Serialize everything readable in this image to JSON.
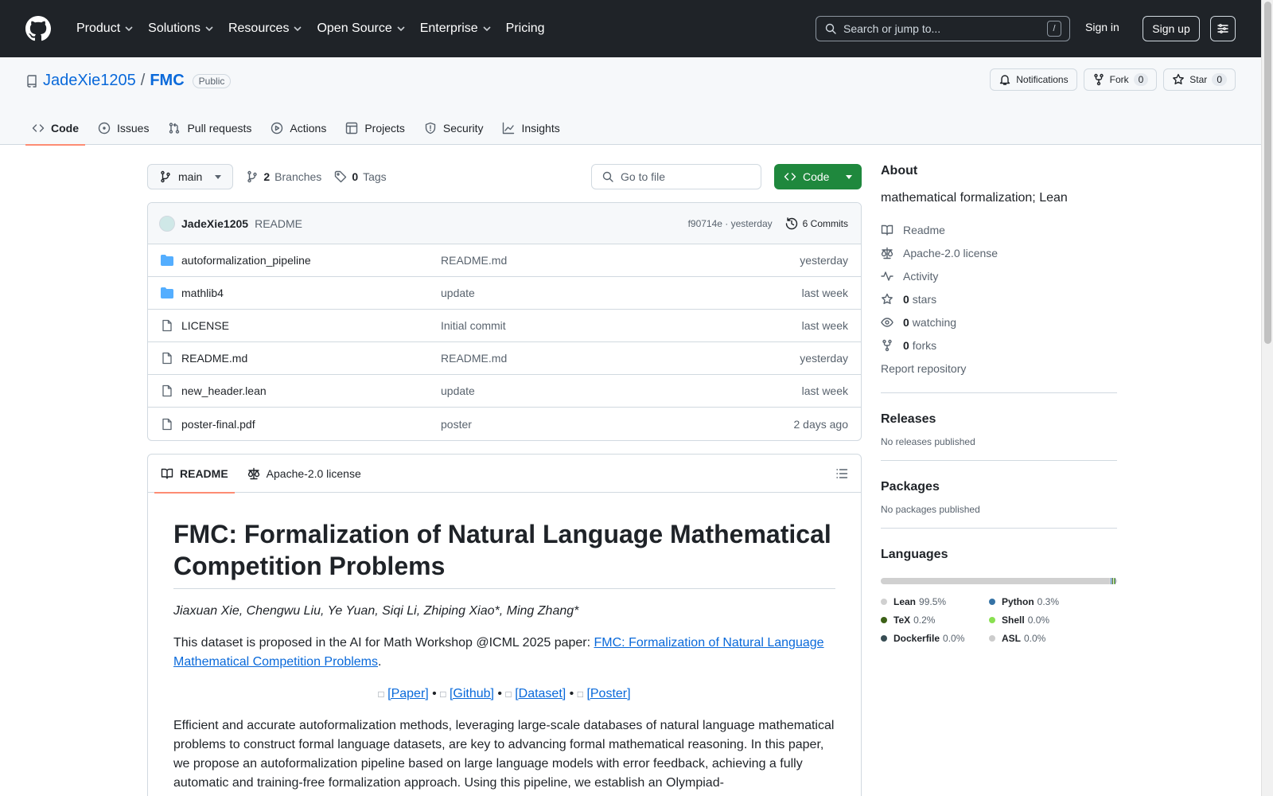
{
  "header": {
    "nav": [
      "Product",
      "Solutions",
      "Resources",
      "Open Source",
      "Enterprise",
      "Pricing"
    ],
    "search_placeholder": "Search or jump to...",
    "search_shortcut": "/",
    "signin": "Sign in",
    "signup": "Sign up"
  },
  "repo": {
    "owner": "JadeXie1205",
    "separator": "/",
    "name": "FMC",
    "visibility": "Public",
    "notifications": "Notifications",
    "fork_label": "Fork",
    "fork_count": "0",
    "star_label": "Star",
    "star_count": "0"
  },
  "tabs": [
    "Code",
    "Issues",
    "Pull requests",
    "Actions",
    "Projects",
    "Security",
    "Insights"
  ],
  "toolbar": {
    "branch": "main",
    "branches_count": "2",
    "branches_label": "Branches",
    "tags_count": "0",
    "tags_label": "Tags",
    "goto_placeholder": "Go to file",
    "code_button": "Code"
  },
  "commit": {
    "author": "JadeXie1205",
    "message": "README",
    "hash_time": "f90714e · yesterday",
    "commits": "6 Commits"
  },
  "files": [
    {
      "type": "folder",
      "name": "autoformalization_pipeline",
      "message": "README.md",
      "date": "yesterday"
    },
    {
      "type": "folder",
      "name": "mathlib4",
      "message": "update",
      "date": "last week"
    },
    {
      "type": "file",
      "name": "LICENSE",
      "message": "Initial commit",
      "date": "last week"
    },
    {
      "type": "file",
      "name": "README.md",
      "message": "README.md",
      "date": "yesterday"
    },
    {
      "type": "file",
      "name": "new_header.lean",
      "message": "update",
      "date": "last week"
    },
    {
      "type": "file",
      "name": "poster-final.pdf",
      "message": "poster",
      "date": "2 days ago"
    }
  ],
  "readme": {
    "tab_readme": "README",
    "tab_license": "Apache-2.0 license",
    "title": "FMC: Formalization of Natural Language Mathematical Competition Problems",
    "authors": "Jiaxuan Xie, Chengwu Liu, Ye Yuan, Siqi Li, Zhiping Xiao*, Ming Zhang*",
    "intro_before": "This dataset is proposed in the AI for Math Workshop @ICML 2025 paper: ",
    "intro_link": "FMC: Formalization of Natural Language Mathematical Competition Problems",
    "intro_after": ".",
    "links": [
      "[Paper]",
      "[Github]",
      "[Dataset]",
      "[Poster]"
    ],
    "bullet": "•",
    "box_glyph": "□",
    "abstract": "Efficient and accurate autoformalization methods, leveraging large-scale databases of natural language mathematical problems to construct formal language datasets, are key to advancing formal mathematical reasoning. In this paper, we propose an autoformalization pipeline based on large language models with error feedback, achieving a fully automatic and training-free formalization approach. Using this pipeline, we establish an Olympiad-"
  },
  "sidebar": {
    "about_title": "About",
    "description": "mathematical formalization; Lean",
    "links": [
      {
        "icon": "book-icon",
        "label": "Readme",
        "count": ""
      },
      {
        "icon": "scale-icon",
        "label": "Apache-2.0 license",
        "count": ""
      },
      {
        "icon": "pulse-icon",
        "label": "Activity",
        "count": ""
      },
      {
        "icon": "star-icon",
        "label": "stars",
        "count": "0"
      },
      {
        "icon": "eye-icon",
        "label": "watching",
        "count": "0"
      },
      {
        "icon": "fork-icon",
        "label": "forks",
        "count": "0"
      }
    ],
    "report": "Report repository",
    "releases_title": "Releases",
    "releases_text": "No releases published",
    "packages_title": "Packages",
    "packages_text": "No packages published",
    "languages_title": "Languages",
    "languages": [
      {
        "name": "Lean",
        "pct": "99.5%",
        "value": 99.5,
        "color": "#d0d0d0"
      },
      {
        "name": "Python",
        "pct": "0.3%",
        "value": 0.3,
        "color": "#3572A5"
      },
      {
        "name": "TeX",
        "pct": "0.2%",
        "value": 0.2,
        "color": "#3D6117"
      },
      {
        "name": "Shell",
        "pct": "0.0%",
        "value": 0.0,
        "color": "#89e051"
      },
      {
        "name": "Dockerfile",
        "pct": "0.0%",
        "value": 0.0,
        "color": "#384d54"
      },
      {
        "name": "ASL",
        "pct": "0.0%",
        "value": 0.0,
        "color": "#cccccc"
      }
    ]
  }
}
